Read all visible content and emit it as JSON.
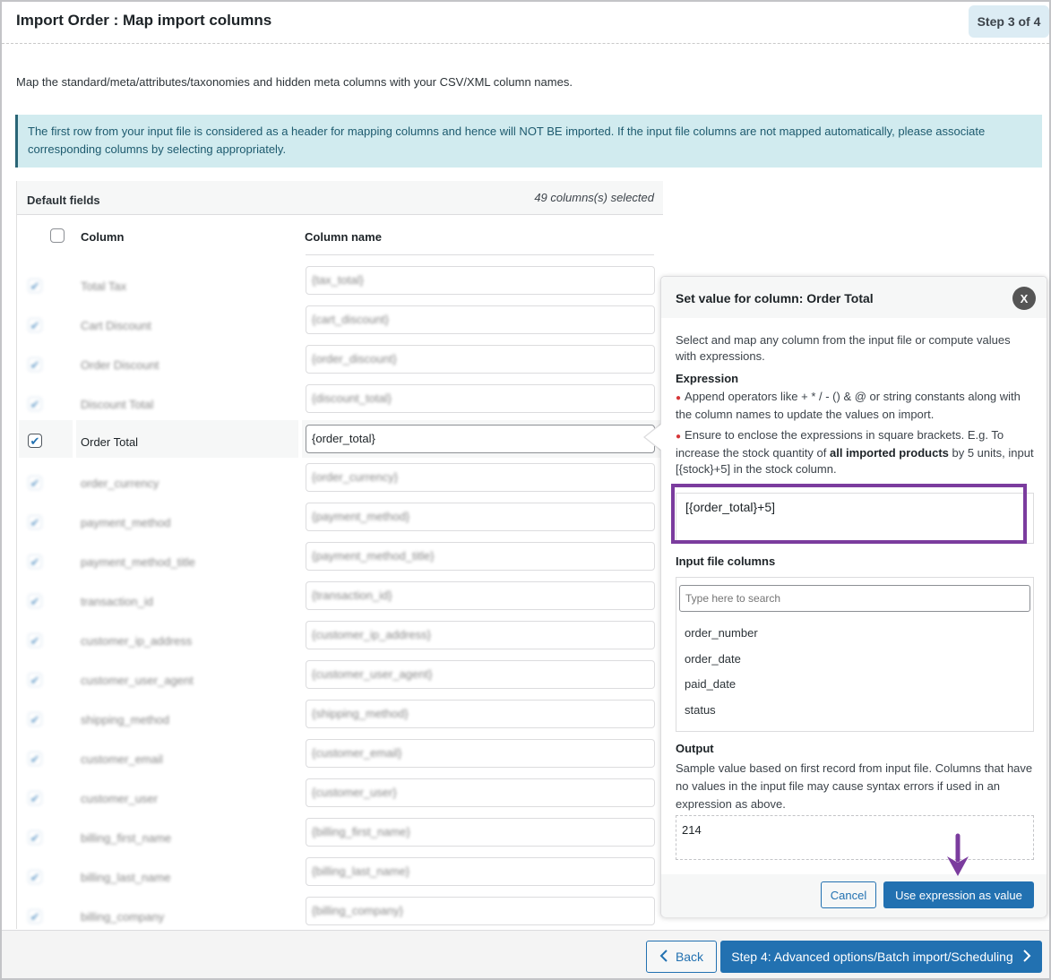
{
  "header": {
    "title": "Import Order : Map import columns",
    "step_badge": "Step 3 of 4"
  },
  "intro_text": "Map the standard/meta/attributes/taxonomies and hidden meta columns with your CSV/XML column names.",
  "notice_text": "The first row from your input file is considered as a header for mapping columns and hence will NOT BE imported. If the input file columns are not mapped automatically, please associate corresponding columns by selecting appropriately.",
  "table": {
    "section_title": "Default fields",
    "selected_count": "49 columns(s) selected",
    "col_header_column": "Column",
    "col_header_name": "Column name",
    "rows": [
      {
        "label": "Total Tax",
        "value": "{tax_total}",
        "checked": true,
        "blurred": true
      },
      {
        "label": "Cart Discount",
        "value": "{cart_discount}",
        "checked": true,
        "blurred": true
      },
      {
        "label": "Order Discount",
        "value": "{order_discount}",
        "checked": true,
        "blurred": true
      },
      {
        "label": "Discount Total",
        "value": "{discount_total}",
        "checked": true,
        "blurred": true
      },
      {
        "label": "Order Total",
        "value": "{order_total}",
        "checked": true,
        "blurred": false
      },
      {
        "label": "order_currency",
        "value": "{order_currency}",
        "checked": true,
        "blurred": true
      },
      {
        "label": "payment_method",
        "value": "{payment_method}",
        "checked": true,
        "blurred": true
      },
      {
        "label": "payment_method_title",
        "value": "{payment_method_title}",
        "checked": true,
        "blurred": true
      },
      {
        "label": "transaction_id",
        "value": "{transaction_id}",
        "checked": true,
        "blurred": true
      },
      {
        "label": "customer_ip_address",
        "value": "{customer_ip_address}",
        "checked": true,
        "blurred": true
      },
      {
        "label": "customer_user_agent",
        "value": "{customer_user_agent}",
        "checked": true,
        "blurred": true
      },
      {
        "label": "shipping_method",
        "value": "{shipping_method}",
        "checked": true,
        "blurred": true
      },
      {
        "label": "customer_email",
        "value": "{customer_email}",
        "checked": true,
        "blurred": true
      },
      {
        "label": "customer_user",
        "value": "{customer_user}",
        "checked": true,
        "blurred": true
      },
      {
        "label": "billing_first_name",
        "value": "{billing_first_name}",
        "checked": true,
        "blurred": true
      },
      {
        "label": "billing_last_name",
        "value": "{billing_last_name}",
        "checked": true,
        "blurred": true
      },
      {
        "label": "billing_company",
        "value": "{billing_company}",
        "checked": true,
        "blurred": true
      }
    ]
  },
  "popup": {
    "title": "Set value for column: Order Total",
    "close_label": "X",
    "intro": "Select and map any column from the input file or compute values with expressions.",
    "expression_title": "Expression",
    "bullet1": "Append operators like + * / - () & @ or string constants along with the column names to update the values on import.",
    "bullet2_pre": "Ensure to enclose the expressions in square brackets. E.g. To increase the stock quantity of ",
    "bullet2_bold": "all imported products",
    "bullet2_post": " by 5 units, input [{stock}+5] in the stock column.",
    "expression_value": "[{order_total}+5]",
    "input_columns_title": "Input file columns",
    "search_placeholder": "Type here to search",
    "input_columns": [
      "order_number",
      "order_date",
      "paid_date",
      "status"
    ],
    "output_title": "Output",
    "output_desc": "Sample value based on first record from input file. Columns that have no values in the input file may cause syntax errors if used in an expression as above.",
    "output_value": "214",
    "cancel_label": "Cancel",
    "use_label": "Use expression as value"
  },
  "footer": {
    "back_label": "Back",
    "next_label": "Step 4: Advanced options/Batch import/Scheduling"
  },
  "colors": {
    "primary": "#2271b1",
    "annotation": "#7b3c9e",
    "notice_bg": "#d1ebef",
    "badge_bg": "#dcecf4"
  }
}
